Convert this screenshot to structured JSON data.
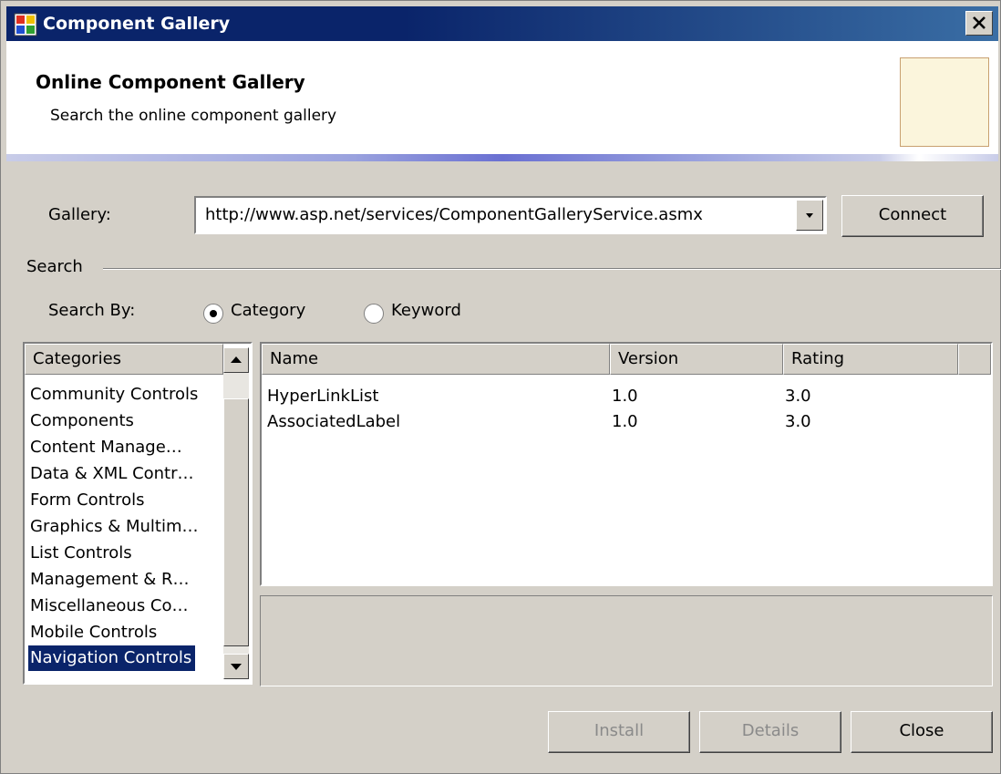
{
  "window": {
    "title": "Component Gallery",
    "close_symbol": "✕"
  },
  "header": {
    "title": "Online Component Gallery",
    "subtitle": "Search the online component gallery"
  },
  "gallery": {
    "label": "Gallery:",
    "url": "http://www.asp.net/services/ComponentGalleryService.asmx",
    "connect_label": "Connect"
  },
  "search": {
    "group_label": "Search",
    "by_label": "Search By:",
    "options": [
      {
        "label": "Category",
        "selected": true
      },
      {
        "label": "Keyword",
        "selected": false
      }
    ]
  },
  "categories": {
    "header": "Categories",
    "items": [
      "Community Controls",
      "Components",
      "Content Manage…",
      "Data & XML Contr…",
      "Form Controls",
      "Graphics & Multim…",
      "List Controls",
      "Management & R…",
      "Miscellaneous Co…",
      "Mobile Controls",
      "Navigation Controls"
    ],
    "selected": "Navigation Controls"
  },
  "results": {
    "columns": [
      "Name",
      "Version",
      "Rating"
    ],
    "rows": [
      {
        "name": "HyperLinkList",
        "version": "1.0",
        "rating": "3.0"
      },
      {
        "name": "AssociatedLabel",
        "version": "1.0",
        "rating": "3.0"
      }
    ]
  },
  "buttons": {
    "install": "Install",
    "details": "Details",
    "close": "Close"
  },
  "colors": {
    "titlebar": "#0a246a",
    "selection": "#0a246a",
    "face": "#d4d0c8",
    "header_box": "#fbf5dc"
  }
}
